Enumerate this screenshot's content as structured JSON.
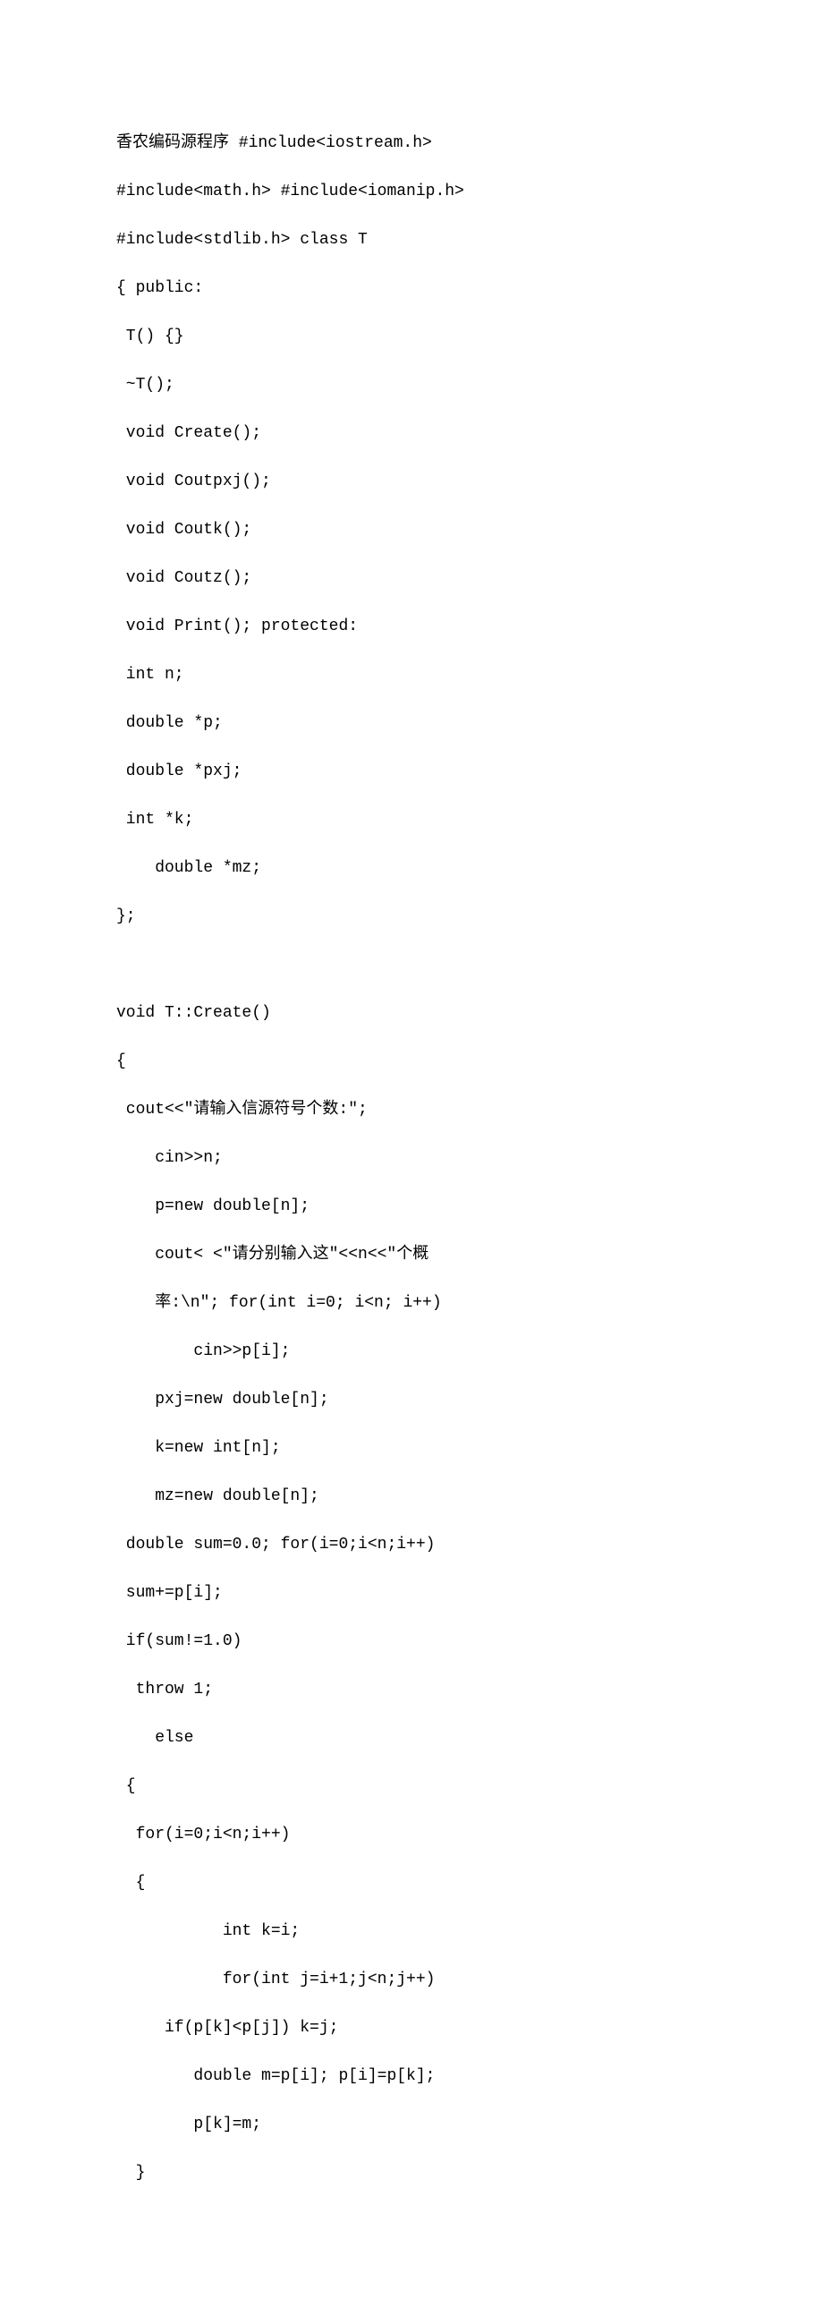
{
  "code": {
    "lines": [
      "香农编码源程序 #include<iostream.h>",
      "#include<math.h> #include<iomanip.h>",
      "#include<stdlib.h> class T",
      "{ public:",
      " T() {}",
      " ~T();",
      " void Create();",
      " void Coutpxj();",
      " void Coutk();",
      " void Coutz();",
      " void Print(); protected:",
      " int n;",
      " double *p;",
      " double *pxj;",
      " int *k;",
      "    double *mz;",
      "};",
      "",
      "void T::Create()",
      "{",
      " cout<<\"请输入信源符号个数:\";",
      "    cin>>n;",
      "    p=new double[n];",
      "    cout< <\"请分别输入这\"<<n<<\"个概",
      "    率:\\n\"; for(int i=0; i<n; i++)",
      "        cin>>p[i];",
      "    pxj=new double[n];",
      "    k=new int[n];",
      "    mz=new double[n];",
      " double sum=0.0; for(i=0;i<n;i++)",
      " sum+=p[i];",
      " if(sum!=1.0)",
      "  throw 1;",
      "    else",
      " {",
      "  for(i=0;i<n;i++)",
      "  {",
      "           int k=i;",
      "           for(int j=i+1;j<n;j++)",
      "     if(p[k]<p[j]) k=j;",
      "        double m=p[i]; p[i]=p[k];",
      "        p[k]=m;",
      "  }"
    ]
  }
}
